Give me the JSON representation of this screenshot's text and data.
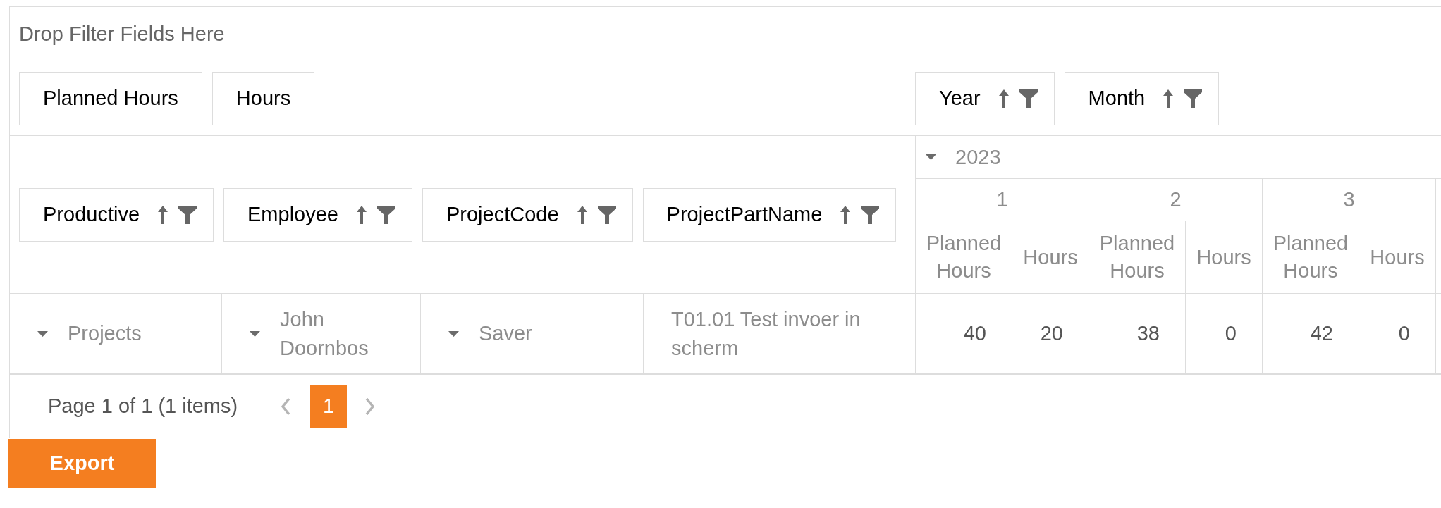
{
  "filter_area": {
    "label": "Drop Filter Fields Here"
  },
  "data_fields": [
    {
      "label": "Planned Hours"
    },
    {
      "label": "Hours"
    }
  ],
  "column_fields": [
    {
      "label": "Year",
      "sorted_ascending": true
    },
    {
      "label": "Month",
      "sorted_ascending": true
    }
  ],
  "row_fields": [
    {
      "label": "Productive",
      "sorted_ascending": true
    },
    {
      "label": "Employee",
      "sorted_ascending": true
    },
    {
      "label": "ProjectCode",
      "sorted_ascending": true
    },
    {
      "label": "ProjectPartName",
      "sorted_ascending": true
    }
  ],
  "column_headers": {
    "year": {
      "label": "2023",
      "expanded": true
    },
    "months": [
      {
        "label": "1",
        "measures": [
          "Planned Hours",
          "Hours"
        ]
      },
      {
        "label": "2",
        "measures": [
          "Planned Hours",
          "Hours"
        ]
      },
      {
        "label": "3",
        "measures": [
          "Planned Hours",
          "Hours"
        ]
      }
    ]
  },
  "rows": [
    {
      "headers": [
        {
          "label": "Projects",
          "expanded": true
        },
        {
          "label": "John Doornbos",
          "expanded": true
        },
        {
          "label": "Saver",
          "expanded": true
        },
        {
          "label": "T01.01 Test invoer in scherm"
        }
      ],
      "values": [
        "40",
        "20",
        "38",
        "0",
        "42",
        "0"
      ]
    }
  ],
  "pager": {
    "summary": "Page 1 of 1 (1 items)",
    "previous": {
      "disabled": true
    },
    "pages": [
      {
        "label": "1",
        "selected": true
      }
    ],
    "next": {
      "disabled": true
    }
  },
  "export_button": {
    "label": "Export"
  }
}
